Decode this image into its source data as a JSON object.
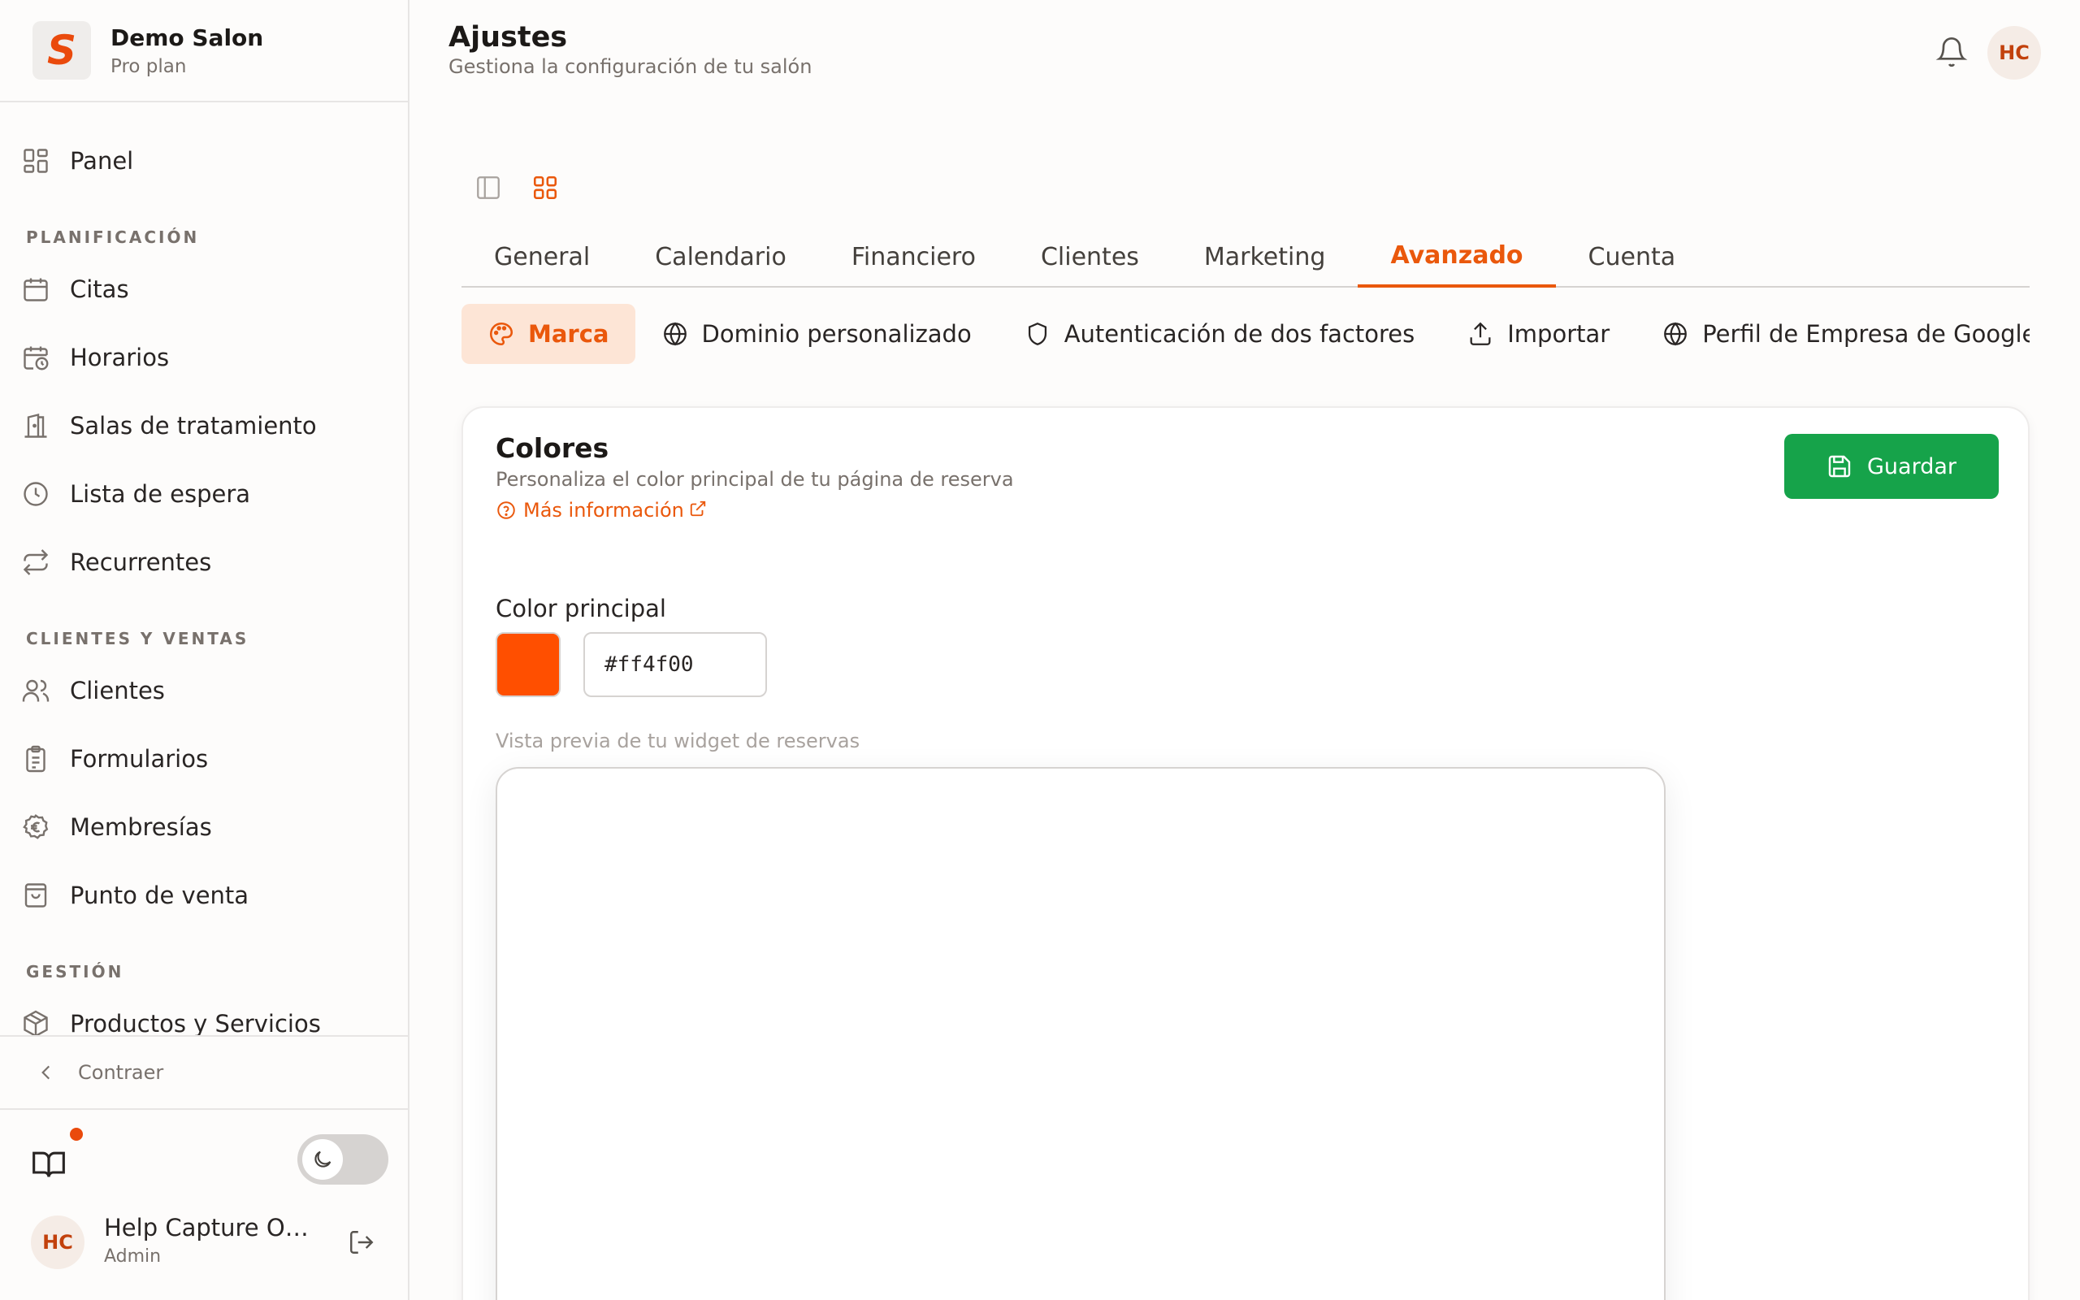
{
  "brand": {
    "logo_letter": "S",
    "name": "Demo Salon",
    "plan": "Pro plan"
  },
  "sidebar": {
    "panel": "Panel",
    "sections": {
      "planning": "PLANIFICACIÓN",
      "clients_sales": "CLIENTES Y VENTAS",
      "management": "GESTIÓN"
    },
    "items": {
      "citas": "Citas",
      "horarios": "Horarios",
      "salas": "Salas de tratamiento",
      "espera": "Lista de espera",
      "recurrentes": "Recurrentes",
      "clientes": "Clientes",
      "formularios": "Formularios",
      "membresias": "Membresías",
      "punto_venta": "Punto de venta",
      "productos": "Productos y Servicios"
    },
    "collapse": "Contraer",
    "user": {
      "initials": "HC",
      "name": "Help Capture Owner",
      "role": "Admin"
    }
  },
  "header": {
    "title": "Ajustes",
    "subtitle": "Gestiona la configuración de tu salón",
    "avatar_initials": "HC"
  },
  "tabs": [
    "General",
    "Calendario",
    "Financiero",
    "Clientes",
    "Marketing",
    "Avanzado",
    "Cuenta"
  ],
  "subtabs": [
    "Marca",
    "Dominio personalizado",
    "Autenticación de dos factores",
    "Importar",
    "Perfil de Empresa de Google"
  ],
  "card": {
    "title": "Colores",
    "description": "Personaliza el color principal de tu página de reserva",
    "more_link": "Más información",
    "save": "Guardar",
    "color_label": "Color principal",
    "color_value": "#ff4f00",
    "preview_label": "Vista previa de tu widget de reservas"
  },
  "colors": {
    "accent": "#ea580c",
    "primary": "#ff4f00",
    "save_button": "#16a34a"
  }
}
